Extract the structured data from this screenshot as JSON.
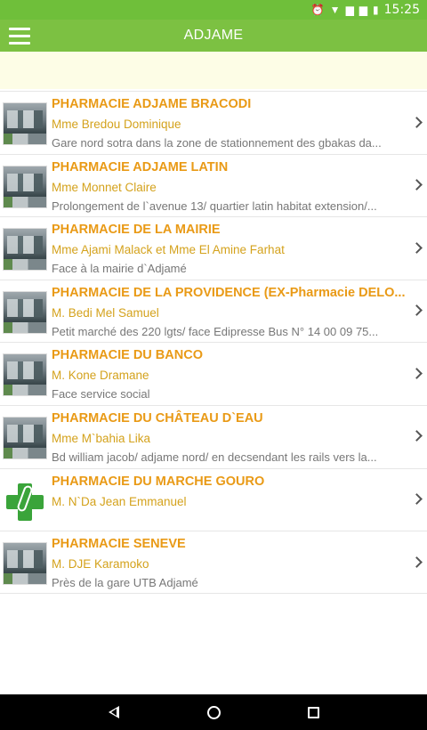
{
  "status_bar": {
    "time": "15:25",
    "icons": [
      "alarm-icon",
      "wifi-icon",
      "sim1-icon",
      "sim2-icon",
      "battery-icon"
    ]
  },
  "app_bar": {
    "title": "ADJAME",
    "menu_icon": "hamburger-menu-icon"
  },
  "colors": {
    "app_bar": "#7cc142",
    "status_bar": "#6fbf3a",
    "name_text": "#e99a16",
    "owner_text": "#d4a21c",
    "address_text": "#777777",
    "banner": "#fdfde6"
  },
  "pharmacies": [
    {
      "name": "PHARMACIE ADJAME BRACODI",
      "owner": "Mme Bredou Dominique",
      "address": "Gare nord sotra dans la zone de stationnement des gbakas da...",
      "thumb": "photo"
    },
    {
      "name": "PHARMACIE ADJAME LATIN",
      "owner": "Mme Monnet Claire",
      "address": "Prolongement de l`avenue 13/ quartier latin habitat extension/...",
      "thumb": "photo"
    },
    {
      "name": "PHARMACIE DE LA MAIRIE",
      "owner": "Mme Ajami Malack et Mme El Amine Farhat",
      "address": "Face à la mairie d`Adjamé",
      "thumb": "photo"
    },
    {
      "name": "PHARMACIE DE LA PROVIDENCE (EX-Pharmacie DELO...",
      "owner": "M. Bedi Mel Samuel",
      "address": "Petit marché des 220 lgts/ face Edipresse Bus N° 14 00 09 75...",
      "thumb": "photo"
    },
    {
      "name": "PHARMACIE DU BANCO",
      "owner": "M. Kone Dramane",
      "address": "Face service social",
      "thumb": "photo"
    },
    {
      "name": "PHARMACIE DU CHÂTEAU D`EAU",
      "owner": "Mme M`bahia Lika",
      "address": "Bd william jacob/ adjame nord/ en decsendant les rails vers la...",
      "thumb": "photo"
    },
    {
      "name": "PHARMACIE DU MARCHE GOURO",
      "owner": "M. N`Da Jean Emmanuel",
      "address": "",
      "thumb": "logo"
    },
    {
      "name": "PHARMACIE SENEVE",
      "owner": "M. DJE  Karamoko",
      "address": "Près de la gare UTB Adjamé",
      "thumb": "photo"
    }
  ],
  "nav_bar": {
    "icons": [
      "back-icon",
      "home-icon",
      "recents-icon"
    ]
  }
}
